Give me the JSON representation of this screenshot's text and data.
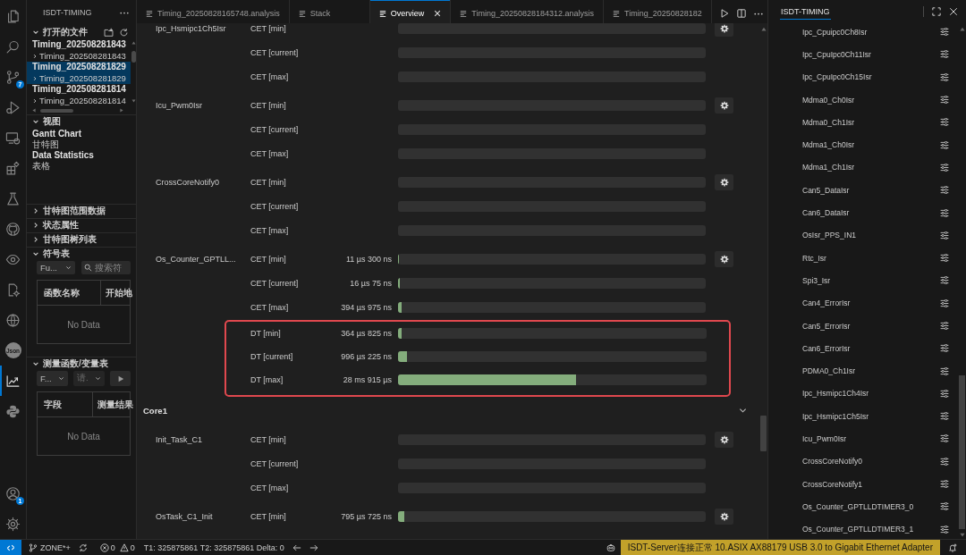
{
  "activity_bar": {
    "top": [
      {
        "selected": false
      },
      {
        "selected": false
      },
      {
        "selected": false,
        "badge": "7"
      },
      {
        "selected": false
      },
      {
        "selected": false
      },
      {
        "selected": false
      },
      {
        "selected": false
      },
      {
        "selected": false
      },
      {
        "selected": false
      },
      {
        "selected": false
      },
      {
        "selected": false
      },
      {
        "selected": false,
        "label": "Json"
      },
      {
        "selected": true
      },
      {
        "selected": false
      }
    ],
    "bottom": [
      {
        "selected": false,
        "badge": "1"
      },
      {
        "selected": false
      }
    ]
  },
  "sidebar": {
    "title": "ISDT-TIMING",
    "sections": [
      {
        "kind": "open_files",
        "title": "打开的文件",
        "expanded": true,
        "files": [
          {
            "name": "Timing_202508281843",
            "selected": false,
            "children": [
              {
                "name": "Timing_202508281843",
                "expanded": false,
                "selected": false
              }
            ]
          },
          {
            "name": "Timing_202508281829",
            "selected": true,
            "children": [
              {
                "name": "Timing_202508281829",
                "expanded": false,
                "selected": true
              }
            ]
          },
          {
            "name": "Timing_202508281814",
            "selected": false,
            "children": [
              {
                "name": "Timing_202508281814",
                "expanded": false,
                "selected": false
              }
            ]
          }
        ]
      },
      {
        "kind": "views",
        "title": "视图",
        "expanded": true,
        "items": [
          {
            "name": "Gantt Chart",
            "description": "甘特图"
          },
          {
            "name": "Data Statistics",
            "description": "表格"
          }
        ]
      },
      {
        "kind": "plain",
        "title": "甘特图范围数据",
        "expanded": false
      },
      {
        "kind": "plain",
        "title": "状态属性",
        "expanded": false
      },
      {
        "kind": "plain",
        "title": "甘特图树列表",
        "expanded": false
      },
      {
        "kind": "symbols",
        "title": "符号表",
        "expanded": true,
        "filter": "Fu...",
        "search": {
          "placeholder": "搜索符"
        },
        "columns": [
          "函数名称",
          "开始地"
        ],
        "empty_text": "No Data"
      },
      {
        "kind": "measure",
        "title": "测量函数/变量表",
        "expanded": true,
        "dropdowns": [
          {
            "value": "F...",
            "disabled": false
          },
          {
            "value": "请.",
            "disabled": true
          }
        ],
        "columns": [
          "字段",
          "测量结果"
        ],
        "empty_text": "No Data"
      }
    ]
  },
  "editor": {
    "tabs": [
      {
        "label": "Timing_20250828165748.analysis",
        "selected": false
      },
      {
        "label": "Stack",
        "selected": false
      },
      {
        "label": "Overview",
        "selected": true
      },
      {
        "label": "Timing_20250828184312.analysis",
        "selected": false
      },
      {
        "label": "Timing_20250828182",
        "selected": false
      }
    ],
    "cores": [
      {
        "tasks": [
          {
            "name": "Ipc_Hsmipc1Ch5Isr",
            "metrics": [
              {
                "label": "CET [min]"
              },
              {
                "label": "CET [current]"
              },
              {
                "label": "CET [max]"
              }
            ]
          },
          {
            "name": "Icu_Pwm0Isr",
            "metrics": [
              {
                "label": "CET [min]"
              },
              {
                "label": "CET [current]"
              },
              {
                "label": "CET [max]"
              }
            ]
          },
          {
            "name": "CrossCoreNotify0",
            "metrics": [
              {
                "label": "CET [min]"
              },
              {
                "label": "CET [current]"
              },
              {
                "label": "CET [max]"
              }
            ]
          },
          {
            "name": "Os_Counter_GPTLL...",
            "metrics": [
              {
                "label": "CET [min]",
                "reading": "11 µs 300 ns",
                "level": 0.004
              },
              {
                "label": "CET [current]",
                "reading": "16 µs 75 ns",
                "level": 0.005
              },
              {
                "label": "CET [max]",
                "reading": "394 µs 975 ns",
                "level": 0.013
              }
            ],
            "framed_metrics": [
              {
                "label": "DT [min]",
                "reading": "364 µs 825 ns",
                "level": 0.012
              },
              {
                "label": "DT [current]",
                "reading": "996 µs 225 ns",
                "level": 0.03
              },
              {
                "label": "DT [max]",
                "reading": "28 ms 915 µs",
                "level": 0.577
              }
            ]
          }
        ]
      },
      {
        "name": "Core1",
        "expanded": true,
        "tasks": [
          {
            "name": "Init_Task_C1",
            "metrics": [
              {
                "label": "CET [min]"
              },
              {
                "label": "CET [current]"
              },
              {
                "label": "CET [max]"
              }
            ]
          },
          {
            "name": "OsTask_C1_Init",
            "metrics": [
              {
                "label": "CET [min]",
                "reading": "795 µs 725 ns",
                "level": 0.02
              }
            ]
          }
        ]
      }
    ]
  },
  "right_panel": {
    "tabs": [
      {
        "label": "ISDT-TIMING",
        "selected": true
      }
    ],
    "items": [
      "Ipc_Cpuipc0Ch8Isr",
      "Ipc_CpuIpc0Ch11Isr",
      "Ipc_CpuIpc0Ch15Isr",
      "Mdma0_Ch0Isr",
      "Mdma0_Ch1Isr",
      "Mdma1_Ch0Isr",
      "Mdma1_Ch1Isr",
      "Can5_DataIsr",
      "Can6_DataIsr",
      "OsIsr_PPS_IN1",
      "Rtc_Isr",
      "Spi3_Isr",
      "Can4_ErrorIsr",
      "Can5_ErrorIsr",
      "Can6_ErrorIsr",
      "PDMA0_Ch1Isr",
      "Ipc_Hsmipc1Ch4Isr",
      "Ipc_Hsmipc1Ch5Isr",
      "Icu_Pwm0Isr",
      "CrossCoreNotify0",
      "CrossCoreNotify1",
      "Os_Counter_GPTLLDTIMER3_0",
      "Os_Counter_GPTLLDTIMER3_1"
    ]
  },
  "status_bar": {
    "branch": "ZONE*+",
    "errors": "0",
    "warnings": "0",
    "timing": "T1: 325875861 T2: 325875861 Delta: 0",
    "server_status": "ISDT-Server连接正常 10.ASIX AX88179 USB 3.0 to Gigabit Ethernet Adapter"
  }
}
